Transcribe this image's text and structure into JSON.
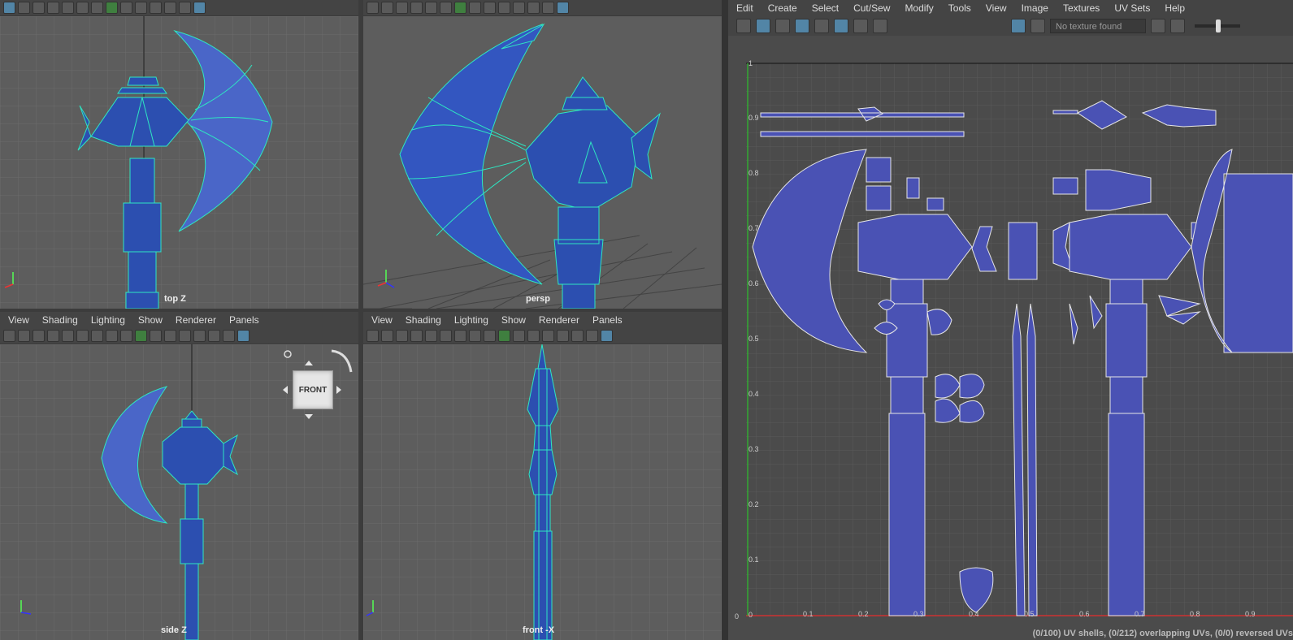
{
  "viewport_menu": [
    "View",
    "Shading",
    "Lighting",
    "Show",
    "Renderer",
    "Panels"
  ],
  "uv_menu": [
    "Edit",
    "Create",
    "Select",
    "Cut/Sew",
    "Modify",
    "Tools",
    "View",
    "Image",
    "Textures",
    "UV Sets",
    "Help"
  ],
  "viewports": {
    "top": {
      "label": "top Z"
    },
    "persp": {
      "label": "persp"
    },
    "side": {
      "label": "side Z"
    },
    "front": {
      "label": "front -X"
    }
  },
  "viewcube_label": "FRONT",
  "uv_editor": {
    "texture_field": "No texture found",
    "v_ticks": [
      "1",
      "0.9",
      "0.8",
      "0.7",
      "0.6",
      "0.5",
      "0.4",
      "0.3",
      "0.2",
      "0.1",
      "0"
    ],
    "u_ticks": [
      "0.1",
      "0.2",
      "0.3",
      "0.4",
      "0.5",
      "0.6",
      "0.7",
      "0.8",
      "0.9"
    ],
    "status": "(0/100) UV shells, (0/212) overlapping UVs, (0/0) reversed UVs"
  },
  "colors": {
    "mesh_fill": "#2c4fb0",
    "wire": "#2ee6c2",
    "uv_fill": "#4a52b4",
    "grid": "#6b6b6b"
  }
}
